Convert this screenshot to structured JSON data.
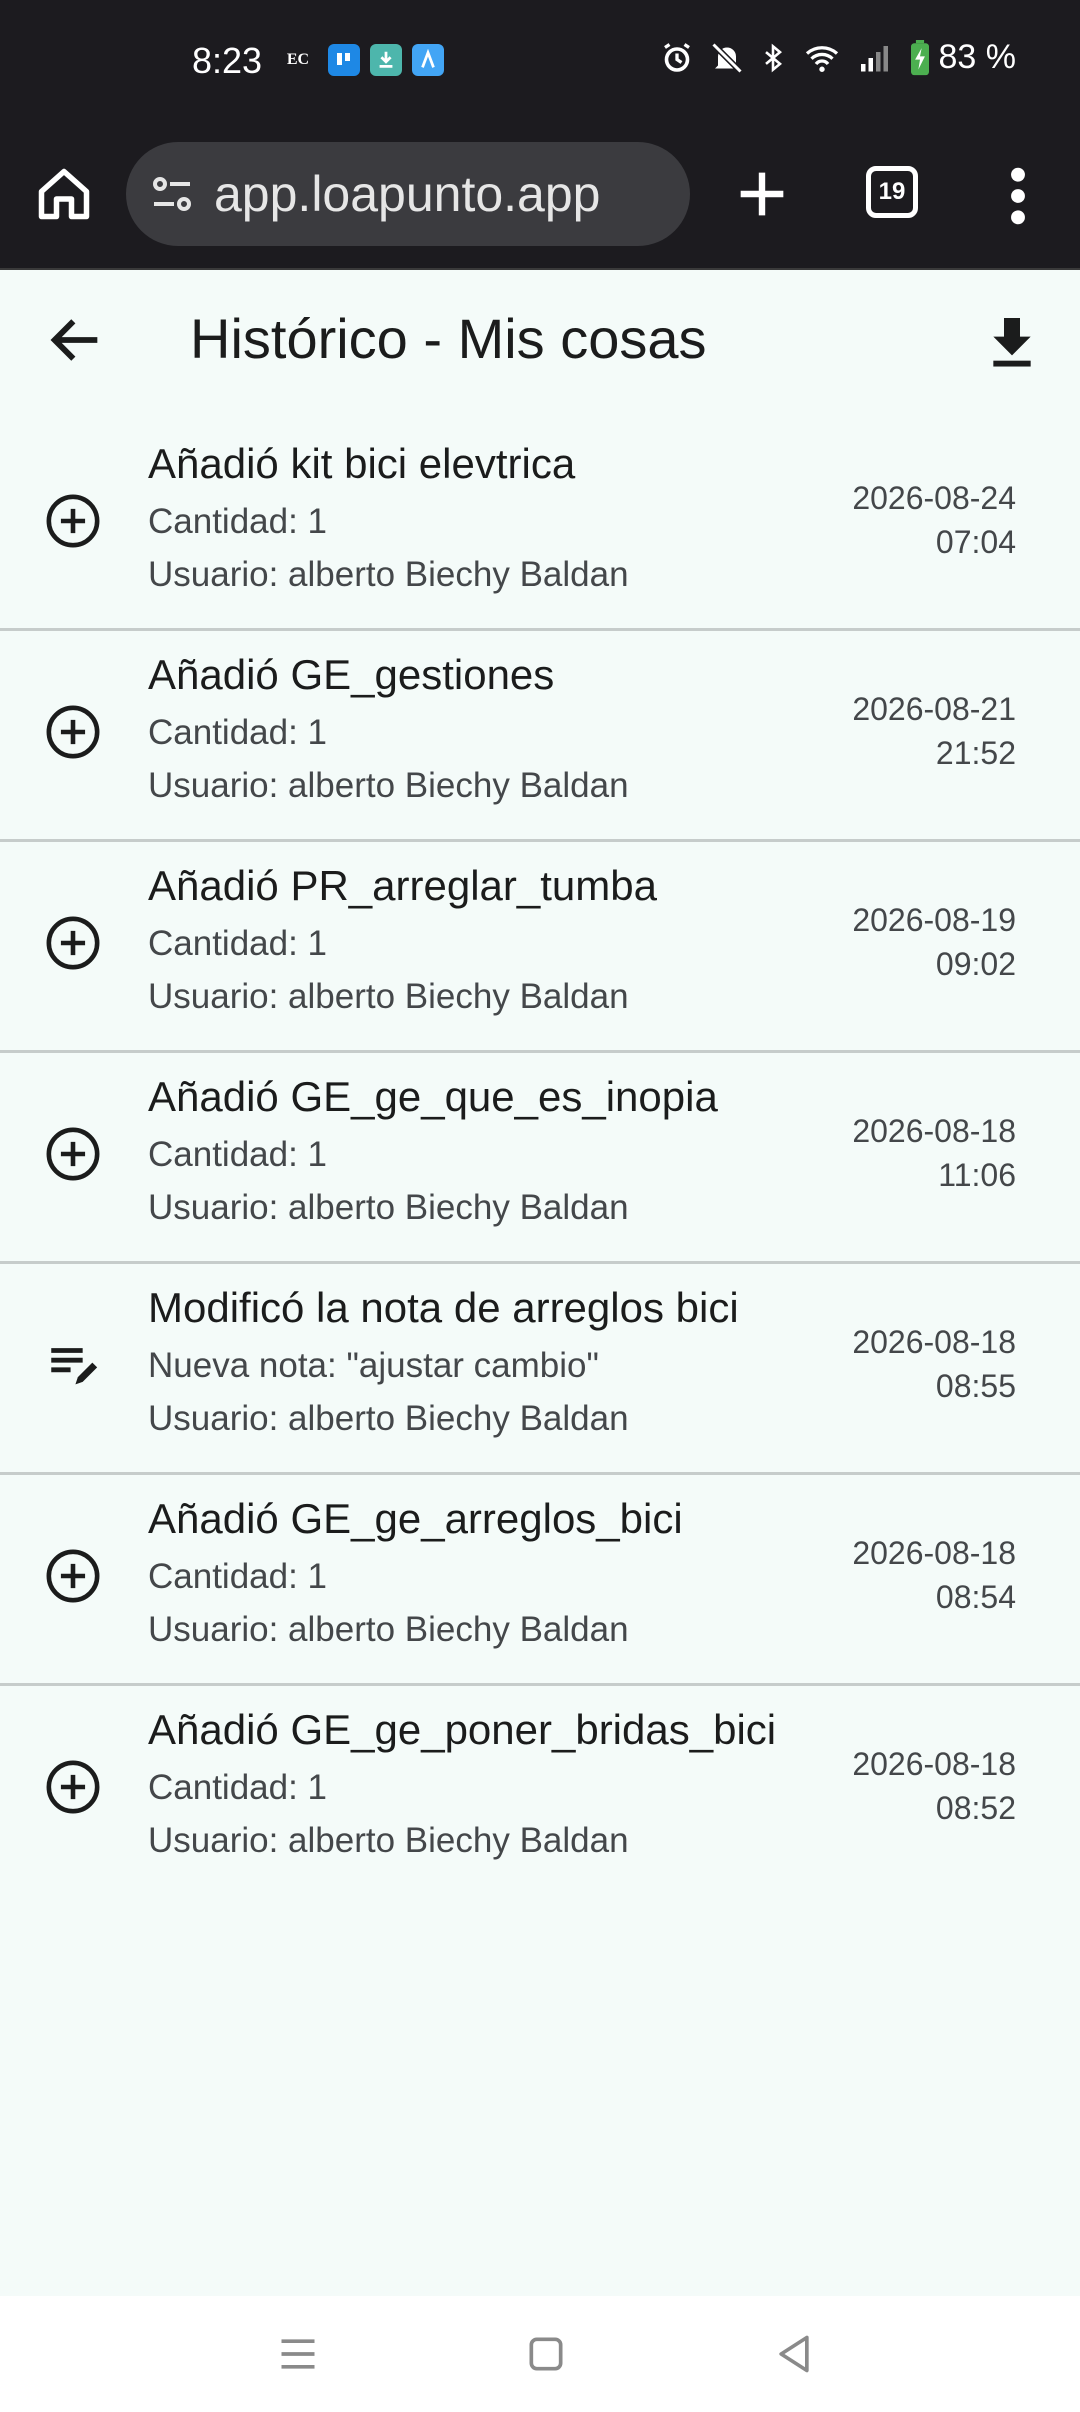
{
  "status_bar": {
    "time": "8:23",
    "apps": [
      "EC",
      "trello-icon",
      "download-icon",
      "app-icon"
    ],
    "battery": "83 %"
  },
  "browser": {
    "url": "app.loapunto.app",
    "tab_count": "19"
  },
  "header": {
    "title": "Histórico - Mis cosas"
  },
  "entries": [
    {
      "icon": "add-circle-icon",
      "title": "Añadió kit bici elevtrica",
      "line1": "Cantidad: 1",
      "line2": "Usuario: alberto Biechy Baldan",
      "date": "2026-08-24",
      "time": "07:04"
    },
    {
      "icon": "add-circle-icon",
      "title": "Añadió GE_gestiones",
      "line1": "Cantidad: 1",
      "line2": "Usuario: alberto Biechy Baldan",
      "date": "2026-08-21",
      "time": "21:52"
    },
    {
      "icon": "add-circle-icon",
      "title": "Añadió PR_arreglar_tumba",
      "line1": "Cantidad: 1",
      "line2": "Usuario: alberto Biechy Baldan",
      "date": "2026-08-19",
      "time": "09:02"
    },
    {
      "icon": "add-circle-icon",
      "title": "Añadió GE_ge_que_es_inopia",
      "line1": "Cantidad: 1",
      "line2": "Usuario: alberto Biechy Baldan",
      "date": "2026-08-18",
      "time": "11:06"
    },
    {
      "icon": "edit-note-icon",
      "title": "Modificó la nota de arreglos bici",
      "line1": "Nueva nota: \"ajustar cambio\"",
      "line2": "Usuario: alberto Biechy Baldan",
      "date": "2026-08-18",
      "time": "08:55"
    },
    {
      "icon": "add-circle-icon",
      "title": "Añadió GE_ge_arreglos_bici",
      "line1": "Cantidad: 1",
      "line2": "Usuario: alberto Biechy Baldan",
      "date": "2026-08-18",
      "time": "08:54"
    },
    {
      "icon": "add-circle-icon",
      "title": "Añadió GE_ge_poner_bridas_bici",
      "line1": "Cantidad: 1",
      "line2": "Usuario: alberto Biechy Baldan",
      "date": "2026-08-18",
      "time": "08:52"
    }
  ],
  "colors": {
    "background": "#f4fbf9",
    "browser_chrome": "#1c1b1f",
    "divider": "#c6cccb"
  }
}
